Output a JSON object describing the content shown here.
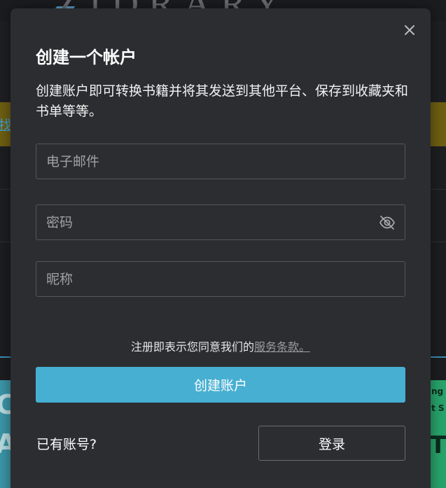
{
  "background": {
    "logo_text": "ZIDRARY",
    "banner_link_text": "找",
    "card_left_letters": [
      "C",
      "A"
    ],
    "card_right_text": [
      "ng",
      "t S",
      "T I"
    ]
  },
  "modal": {
    "close_icon": "close-icon",
    "title": "创建一个帐户",
    "description": "创建账户即可转换书籍并将其发送到其他平台、保存到收藏夹和书单等等。",
    "email_placeholder": "电子邮件",
    "password_placeholder": "密码",
    "password_toggle_icon": "eye-slash-icon",
    "nickname_placeholder": "昵称",
    "terms_text": "注册即表示您同意我们的",
    "terms_link": "服务条款。",
    "create_button_label": "创建账户",
    "have_account_text": "已有账号?",
    "login_button_label": "登录"
  },
  "colors": {
    "modal_bg": "#2c2d31",
    "primary_button": "#47afd2",
    "field_border": "#55575c"
  }
}
